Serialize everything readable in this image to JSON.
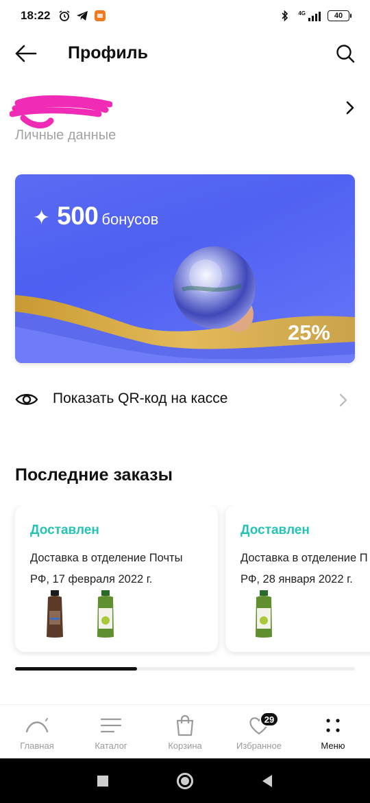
{
  "status_bar": {
    "time": "18:22",
    "battery": "40",
    "network": "4G"
  },
  "header": {
    "title": "Профиль"
  },
  "profile": {
    "subtitle": "Личные данные"
  },
  "bonus_card": {
    "amount": "500",
    "unit": "бонусов",
    "discount": "25%",
    "colors": {
      "background": "#4a5cf0",
      "wave": "#d8ad45"
    }
  },
  "qr": {
    "label": "Показать QR-код на кассе"
  },
  "orders": {
    "title": "Последние заказы",
    "items": [
      {
        "status": "Доставлен",
        "line1": "Доставка в отделение Почты",
        "line2": "РФ, 17 февраля 2022 г.",
        "products": [
          "brown-shampoo-bottle",
          "green-shampoo-bottle"
        ]
      },
      {
        "status": "Доставлен",
        "line1": "Доставка в отделение П",
        "line2": "РФ, 28 января 2022 г.",
        "products": [
          "green-shampoo-bottle"
        ]
      }
    ],
    "status_color": "#25c3b2"
  },
  "bottom_nav": {
    "items": [
      {
        "label": "Главная",
        "icon": "home-arc-icon"
      },
      {
        "label": "Каталог",
        "icon": "catalog-lines-icon"
      },
      {
        "label": "Корзина",
        "icon": "bag-icon"
      },
      {
        "label": "Избранное",
        "icon": "heart-icon",
        "badge": "29"
      },
      {
        "label": "Меню",
        "icon": "menu-dots-icon",
        "active": true
      }
    ]
  }
}
